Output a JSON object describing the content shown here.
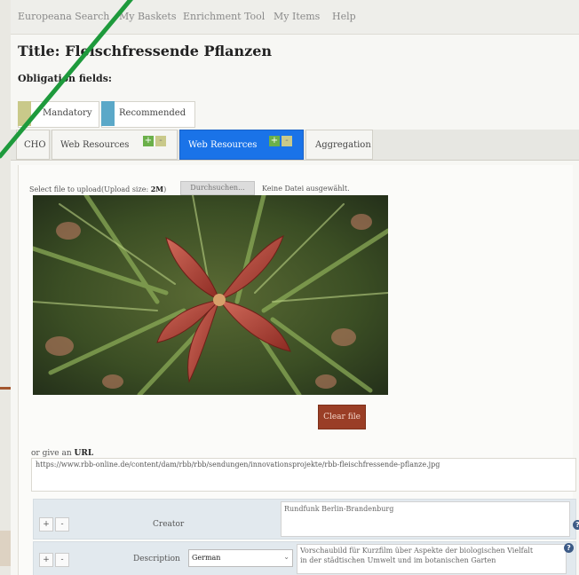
{
  "nav": [
    "Europeana Search",
    "My Baskets",
    "Enrichment Tool",
    "My Items",
    "Help"
  ],
  "title": "Title: Fleischfressende Pflanzen",
  "obligation_label": "Obligation fields:",
  "legend": {
    "mandatory": "Mandatory",
    "recommended": "Recommended",
    "mandatory_color": "#c9c98a",
    "recommended_color": "#5ba8c8"
  },
  "tabs": [
    "CHO",
    "Web Resources",
    "Web Resources",
    "Aggregation"
  ],
  "tab_controls": {
    "add": "+",
    "remove": "-"
  },
  "upload": {
    "label_prefix": "Select file to upload(Upload size:",
    "size": "2M",
    "label_suffix": ")",
    "button": "Durchsuchen...",
    "no_file": "Keine Datei ausgewählt."
  },
  "clear_button": "Clear file",
  "url": {
    "label_prefix": "or give an",
    "label_bold": "URL",
    "value": "https://www.rbb-online.de/content/dam/rbb/rbb/sendungen/innovationsprojekte/rbb-fleischfressende-pflanze.jpg"
  },
  "rows": [
    {
      "add": "+",
      "remove": "-",
      "label": "Creator",
      "value": "Rundfunk Berlin-Brandenburg",
      "help": "?"
    },
    {
      "add": "+",
      "remove": "-",
      "label": "Description",
      "language": "German",
      "value_line1": "Vorschaubild für Kurzfilm über Aspekte der biologischen Vielfalt",
      "value_line2": "in der städtischen Umwelt und im botanischen Garten",
      "help": "?"
    }
  ],
  "colors": {
    "active_tab": "#1a73e8",
    "clear_button": "#9a3e26",
    "arrow": "#1e9a3c"
  }
}
